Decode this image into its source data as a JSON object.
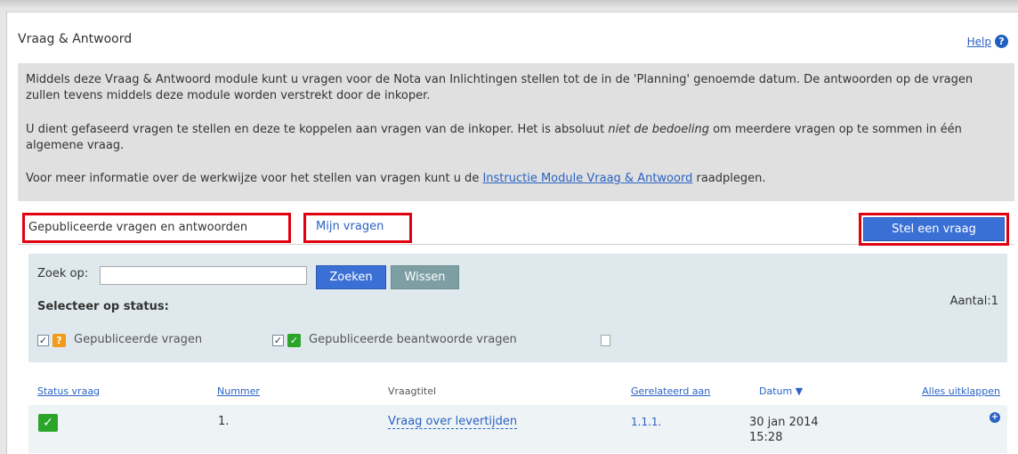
{
  "header": {
    "title": "Vraag & Antwoord",
    "help_label": "Help",
    "help_icon": "question-circle-icon"
  },
  "info": {
    "p1": "Middels deze Vraag & Antwoord module kunt u vragen voor de Nota van Inlichtingen stellen tot de in de 'Planning' genoemde datum. De antwoorden op de vragen zullen tevens middels deze module worden verstrekt door de inkoper.",
    "p2_a": "U dient gefaseerd vragen te stellen en deze te koppelen aan vragen van de inkoper. Het is absoluut ",
    "p2_em": "niet de bedoeling",
    "p2_b": " om meerdere vragen op te sommen in één algemene vraag.",
    "p3_a": "Voor meer informatie over de werkwijze voor het stellen van vragen kunt u de ",
    "p3_link": "Instructie Module Vraag & Antwoord",
    "p3_b": " raadplegen."
  },
  "tabs": {
    "published": "Gepubliceerde vragen en antwoorden",
    "mine": "Mijn vragen"
  },
  "ask_button": "Stel een vraag",
  "filter": {
    "search_label": "Zoek op:",
    "search_value": "",
    "search_button": "Zoeken",
    "clear_button": "Wissen",
    "status_label": "Selecteer op status:",
    "count": "Aantal:1",
    "statuses": [
      {
        "label": "Gepubliceerde vragen",
        "checked": true,
        "icon": "question-icon",
        "color": "#f29a1a"
      },
      {
        "label": "Gepubliceerde beantwoorde vragen",
        "checked": true,
        "icon": "check-icon",
        "color": "#2aa52a"
      }
    ]
  },
  "table": {
    "headers": {
      "status": "Status vraag",
      "number": "Nummer",
      "title": "Vraagtitel",
      "related": "Gerelateerd aan",
      "date": "Datum ▼",
      "expand_all": "Alles uitklappen"
    },
    "rows": [
      {
        "status_icon": "check-icon",
        "number": "1.",
        "title": "Vraag over levertijden",
        "related": "1.1.1.",
        "date": "30 jan 2014",
        "time": "15:28"
      }
    ]
  },
  "colors": {
    "accent": "#3a70d6",
    "highlight_border": "#e00010",
    "filter_bg": "#dfe9ed"
  }
}
